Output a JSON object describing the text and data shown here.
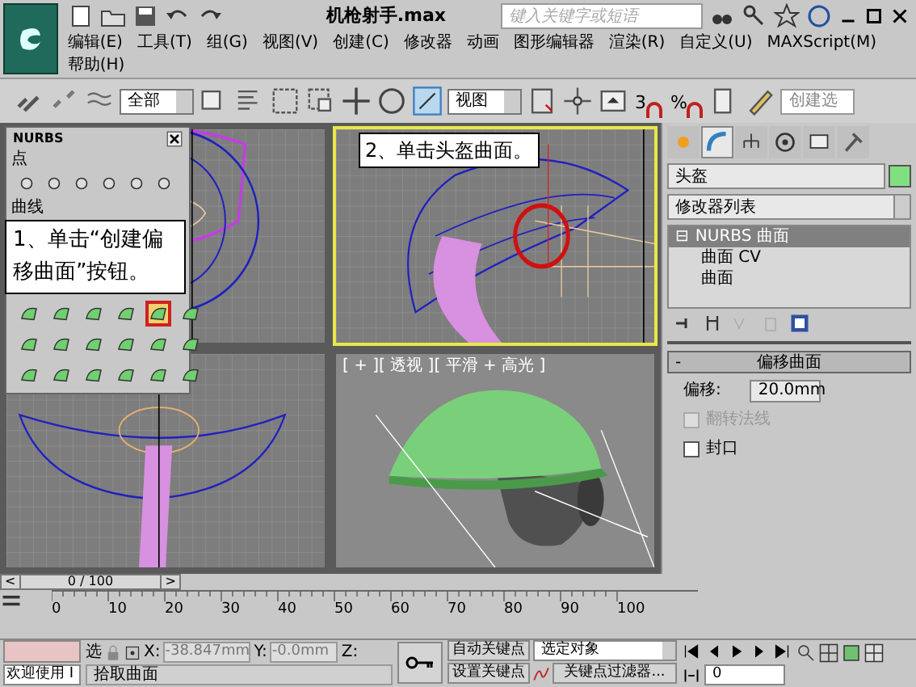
{
  "app": {
    "title": "机枪射手.max",
    "search": {
      "placeholder": "键入关键字或短语"
    }
  },
  "menu": [
    {
      "label": "编辑(E)"
    },
    {
      "label": "工具(T)"
    },
    {
      "label": "组(G)"
    },
    {
      "label": "视图(V)"
    },
    {
      "label": "创建(C)"
    },
    {
      "label": "修改器"
    },
    {
      "label": "动画"
    },
    {
      "label": "图形编辑器"
    },
    {
      "label": "渲染(R)"
    },
    {
      "label": "自定义(U)"
    },
    {
      "label": "MAXScript(M)"
    },
    {
      "label": "帮助(H)"
    }
  ],
  "toolbar": {
    "selection_filter": "全部",
    "coordinate_system": "视图",
    "snaps": [
      "3",
      "%"
    ],
    "named_selection": {
      "placeholder": "创建选"
    }
  },
  "viewports": [
    {
      "kind": "front",
      "active": false
    },
    {
      "kind": "top",
      "active": true
    },
    {
      "kind": "left",
      "active": false
    },
    {
      "kind": "perspective",
      "active": false,
      "label": "[ + ][ 透视 ][ 平滑 + 高光 ]"
    }
  ],
  "nurbs_panel": {
    "title": "NURBS",
    "sections": [
      "点",
      "曲线"
    ]
  },
  "callouts": [
    {
      "text": "1、单击“创建偏移曲面”按钮。"
    },
    {
      "text": "2、单击头盔曲面。"
    }
  ],
  "command_panel": {
    "tabs": [
      {
        "kind": "create",
        "selected": false
      },
      {
        "kind": "modify",
        "selected": true
      },
      {
        "kind": "hierarchy",
        "selected": false
      },
      {
        "kind": "motion",
        "selected": false
      },
      {
        "kind": "display",
        "selected": false
      },
      {
        "kind": "utilities",
        "selected": false
      }
    ],
    "object_name": "头盔",
    "modifier_list": "修改器列表",
    "stack": [
      {
        "toggle": "⊟",
        "label": "NURBS 曲面",
        "selected": true,
        "children": [
          {
            "label": "曲面 CV",
            "selected": false
          },
          {
            "label": "曲面",
            "selected": false
          }
        ]
      }
    ],
    "rollout": {
      "toggle": "-",
      "title": "偏移曲面",
      "offset": {
        "label": "偏移:",
        "value": "20.0mm"
      },
      "checkboxes": [
        {
          "label": "翻转法线",
          "checked": false,
          "disabled": true
        },
        {
          "label": "封口",
          "checked": false,
          "disabled": false
        }
      ]
    }
  },
  "timeline": {
    "level": 0,
    "frame": "0 / 100",
    "prev": "<",
    "next": ">",
    "ticks": [
      "0",
      "10",
      "20",
      "30",
      "40",
      "50",
      "60",
      "70",
      "80",
      "90",
      "100"
    ]
  },
  "status": {
    "message": "欢迎使用 I",
    "lock_label": "选",
    "x": {
      "label": "X:",
      "value": "-38.847mm",
      "disabled": true
    },
    "y": {
      "label": "Y:",
      "value": "-0.0mm",
      "disabled": true
    },
    "z": {
      "label": "Z:"
    },
    "prompt": "拾取曲面",
    "auto_key": "自动关键点",
    "set_key": "设置关键点",
    "key_mode": "选定对象",
    "key_filters": "关键点过滤器...",
    "current_frame": "0"
  }
}
